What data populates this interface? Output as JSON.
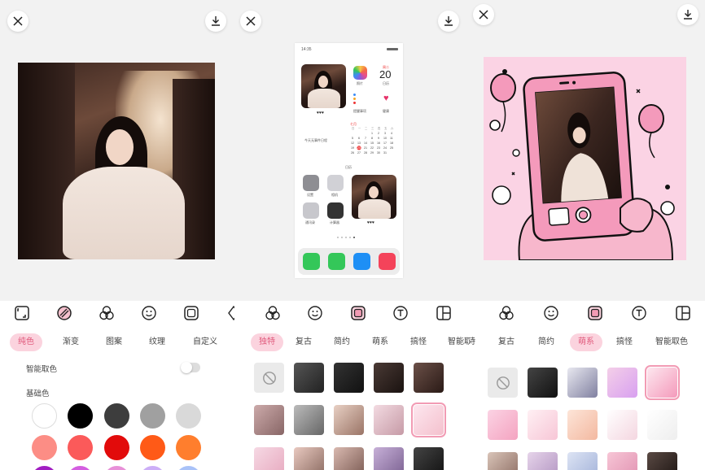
{
  "panel1": {
    "tools": [
      "crop-icon",
      "stripes-icon",
      "filter-icon",
      "smiley-icon",
      "frame-icon",
      "shape-icon"
    ],
    "tabs": [
      "纯色",
      "渐变",
      "图案",
      "纹理",
      "自定义"
    ],
    "active_tab": 0,
    "smart_color_label": "智能取色",
    "basic_color_label": "基础色",
    "swatches": [
      "#ffffff",
      "#000000",
      "#3d3d3d",
      "#a0a0a0",
      "#d9d9d9",
      "#fc8d85",
      "#fb5a5a",
      "#e20b0b",
      "#ff5a17",
      "#ff7e2d",
      "#a11ec2",
      "#d45ee0",
      "#e890d8",
      "#ccaef7",
      "#a9c2f8"
    ]
  },
  "panel2": {
    "phone": {
      "time": "14:35",
      "date_day": "20",
      "date_week": "周二",
      "photos_label": "照片",
      "calendar_label": "日历",
      "reminders_label": "提醒事项",
      "health_label": "健康",
      "hearts": "♥♥♥",
      "no_events": "今天无事件日程",
      "month_label": "七月",
      "calendar_widget_label": "日历",
      "settings_label": "设置",
      "camera_label": "相机",
      "contacts_label": "通讯录",
      "calculator_label": "计算器"
    },
    "tools": [
      "filter-icon",
      "smiley-icon",
      "frame-icon",
      "text-icon",
      "layout-icon"
    ],
    "tabs": [
      "独特",
      "复古",
      "简约",
      "萌系",
      "搞怪",
      "智能取"
    ],
    "active_tab": 0
  },
  "panel3": {
    "tools": [
      "filter-icon",
      "smiley-icon",
      "frame-icon",
      "text-icon",
      "layout-icon"
    ],
    "tabs": [
      "独特",
      "复古",
      "简约",
      "萌系",
      "搞怪",
      "智能取色"
    ],
    "active_tab": 3
  },
  "colors": {
    "accent_pink": "#e05a7c",
    "tab_active_bg": "#fbd3de"
  }
}
